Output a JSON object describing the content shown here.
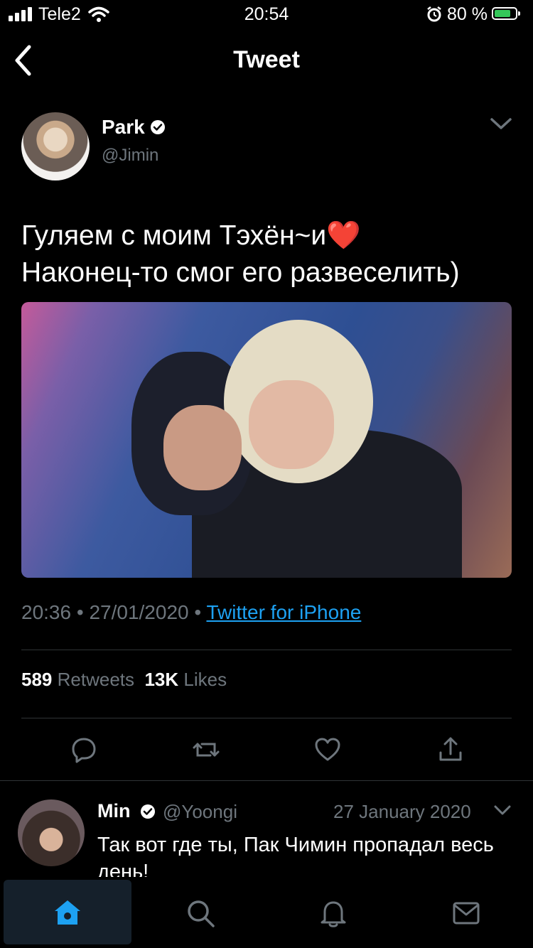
{
  "status_bar": {
    "carrier": "Tele2",
    "time": "20:54",
    "battery_percent": "80 %",
    "battery_level": 0.8,
    "icons": [
      "signal-icon",
      "wifi-icon",
      "alarm-icon",
      "battery-icon"
    ]
  },
  "header": {
    "title": "Tweet",
    "back_icon": "chevron-left-icon"
  },
  "tweet": {
    "author_name": "Park",
    "author_handle": "@Jimin",
    "text_line1": "Гуляем с моим Тэхён~и",
    "emoji": "❤️",
    "text_line2": "Наконец-то смог его развеселить)",
    "time": "20:36",
    "date": "27/01/2020",
    "source": "Twitter for iPhone",
    "retweets_count": "589",
    "retweets_label": "Retweets",
    "likes_count": "13K",
    "likes_label": "Likes",
    "separator": "•"
  },
  "actions": [
    "reply-icon",
    "retweet-icon",
    "like-icon",
    "share-icon"
  ],
  "reply": {
    "author_name": "Min",
    "author_handle": "@Yoongi",
    "date": "27 January 2020",
    "text": "Так вот где ты, Пак Чимин пропадал весь день!"
  },
  "tab_bar": {
    "items": [
      "home-icon",
      "search-icon",
      "notifications-icon",
      "messages-icon"
    ],
    "active": "home-icon",
    "accent": "#1da1f2"
  },
  "colors": {
    "background": "#000000",
    "secondary_text": "#6e767d",
    "link": "#1da1f2",
    "verified": "#ffffff"
  }
}
